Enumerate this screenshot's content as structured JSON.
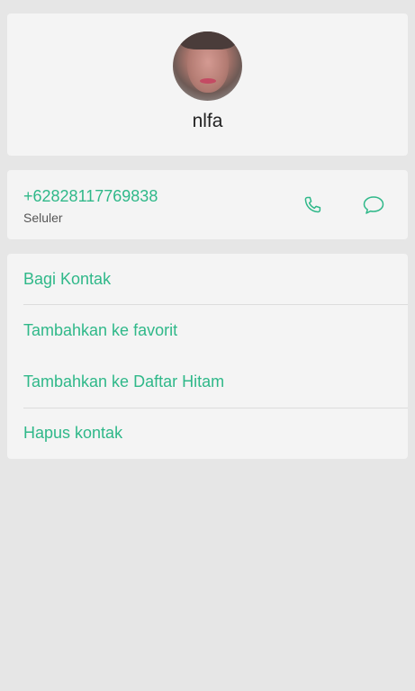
{
  "contact": {
    "name": "nlfa"
  },
  "phone": {
    "number": "+62828117769838",
    "type": "Seluler"
  },
  "actions": [
    {
      "label": "Bagi Kontak"
    },
    {
      "label": "Tambahkan ke favorit"
    },
    {
      "label": "Tambahkan ke Daftar Hitam"
    },
    {
      "label": "Hapus kontak"
    }
  ],
  "colors": {
    "accent": "#2fb889",
    "card": "#f4f4f4",
    "background": "#e6e6e6"
  },
  "icons": {
    "call": "phone-icon",
    "message": "chat-bubble-icon"
  }
}
